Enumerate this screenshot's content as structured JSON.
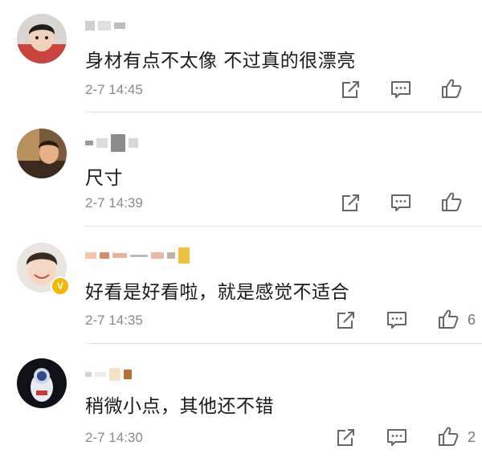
{
  "comments": [
    {
      "text": "身材有点不太像 不过真的很漂亮",
      "time": "2-7 14:45",
      "like_count": ""
    },
    {
      "text": "尺寸",
      "time": "2-7 14:39",
      "like_count": ""
    },
    {
      "text": "好看是好看啦，就是感觉不适合",
      "time": "2-7 14:35",
      "like_count": "6",
      "verified_badge": "V"
    },
    {
      "text": "稍微小点，其他还不错",
      "time": "2-7 14:30",
      "like_count": "2"
    }
  ],
  "icons": {
    "share": "share-icon",
    "reply": "comment-icon",
    "like": "thumbs-up-icon"
  },
  "colors": {
    "text": "#1a1a1a",
    "time": "#8a8a8a",
    "icon": "#666666",
    "badge": "#f2b705"
  }
}
